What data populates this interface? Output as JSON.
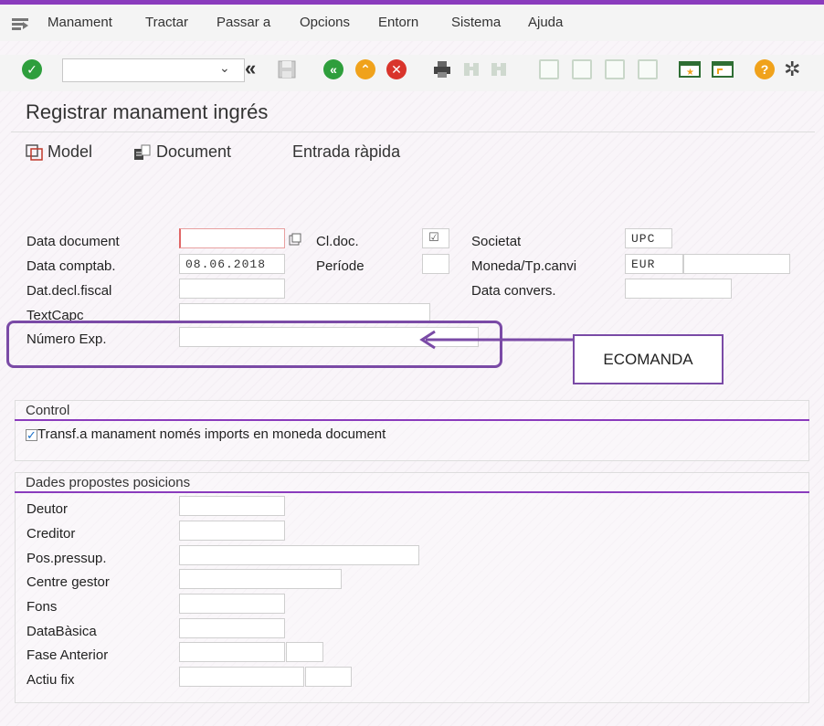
{
  "menu": {
    "items": [
      {
        "label": "Manament"
      },
      {
        "label": "Tractar"
      },
      {
        "label": "Passar a"
      },
      {
        "label": "Opcions"
      },
      {
        "label": "Entorn"
      },
      {
        "label": "Sistema"
      },
      {
        "label": "Ajuda"
      }
    ]
  },
  "toolbar": {
    "command_value": "",
    "icons": [
      "check-icon",
      "dropdown-chevron-icon",
      "double-left-arrow-icon",
      "save-icon",
      "back-icon",
      "exit-icon",
      "cancel-icon",
      "print-icon",
      "find-icon",
      "find-next-icon",
      "first-page-icon",
      "previous-page-icon",
      "next-page-icon",
      "last-page-icon",
      "create-session-icon",
      "shortcut-icon",
      "help-icon",
      "settings-icon"
    ],
    "colors": {
      "green": "#2e9e3c",
      "orange": "#f0a21b",
      "red": "#d9342b",
      "purple": "#8a3bbd"
    }
  },
  "page": {
    "title": "Registrar manament ingrés"
  },
  "app_toolbar": {
    "model_label": "Model",
    "document_label": "Document",
    "quick_entry_label": "Entrada ràpida"
  },
  "header_fields": {
    "data_document": {
      "label": "Data document",
      "value": ""
    },
    "cl_doc": {
      "label": "Cl.doc.",
      "value": ""
    },
    "societat": {
      "label": "Societat",
      "value": "UPC"
    },
    "data_comptab": {
      "label": "Data comptab.",
      "value": "08.06.2018"
    },
    "periode": {
      "label": "Període",
      "value": ""
    },
    "moneda": {
      "label": "Moneda/Tp.canvi",
      "value": "EUR",
      "rate_value": ""
    },
    "dat_decl_fiscal": {
      "label": "Dat.decl.fiscal",
      "value": ""
    },
    "data_convers": {
      "label": "Data convers.",
      "value": ""
    },
    "text_capc": {
      "label": "TextCapc",
      "value": ""
    },
    "numero_exp": {
      "label": "Número Exp.",
      "value": ""
    }
  },
  "annotation": {
    "label": "ECOMANDA"
  },
  "control": {
    "title": "Control",
    "checkbox_label": "Transf.a manament només imports en moneda document",
    "checked": true
  },
  "positions": {
    "title": "Dades propostes posicions",
    "fields": [
      {
        "label": "Deutor",
        "value": ""
      },
      {
        "label": "Creditor",
        "value": ""
      },
      {
        "label": "Pos.pressup.",
        "value": ""
      },
      {
        "label": "Centre gestor",
        "value": ""
      },
      {
        "label": "Fons",
        "value": ""
      },
      {
        "label": "DataBàsica",
        "value": ""
      },
      {
        "label": "Fase Anterior",
        "value": "",
        "value2": ""
      },
      {
        "label": "Actiu fix",
        "value": "",
        "value2": ""
      }
    ]
  }
}
